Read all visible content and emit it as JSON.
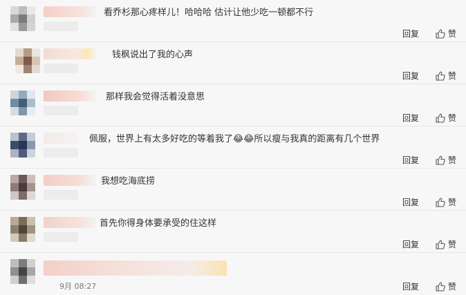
{
  "comments": [
    {
      "text": "看乔杉那心疼样儿！哈哈哈 估计让他少吃一顿都不行",
      "reply": "回复",
      "like": "赞",
      "text_x": 150
    },
    {
      "text": "钱枫说出了我的心声",
      "reply": "回复",
      "like": "赞",
      "text_x": 162
    },
    {
      "text": "那样我会觉得活着没意思",
      "reply": "回复",
      "like": "赞",
      "text_x": 153
    },
    {
      "text": "佩服，世界上有太多好吃的等着我了😂😂所以瘦与我真的距离有几个世界",
      "reply": "回复",
      "like": "赞",
      "text_x": 129
    },
    {
      "text": "我想吃海底捞",
      "reply": "回复",
      "like": "赞",
      "text_x": 146
    },
    {
      "text": "首先你得身体要承受的住这样",
      "reply": "回复",
      "like": "赞",
      "text_x": 144
    }
  ],
  "partial": {
    "date": "9月 08:27",
    "reply": "回复",
    "like": "赞"
  },
  "icons": {
    "thumb": "thumbs-up-icon",
    "emoji_laugh": "laugh-emoji-icon",
    "emoji_cry": "cry-laugh-emoji-icon",
    "emoji_sad": "pleading-emoji-icon"
  }
}
